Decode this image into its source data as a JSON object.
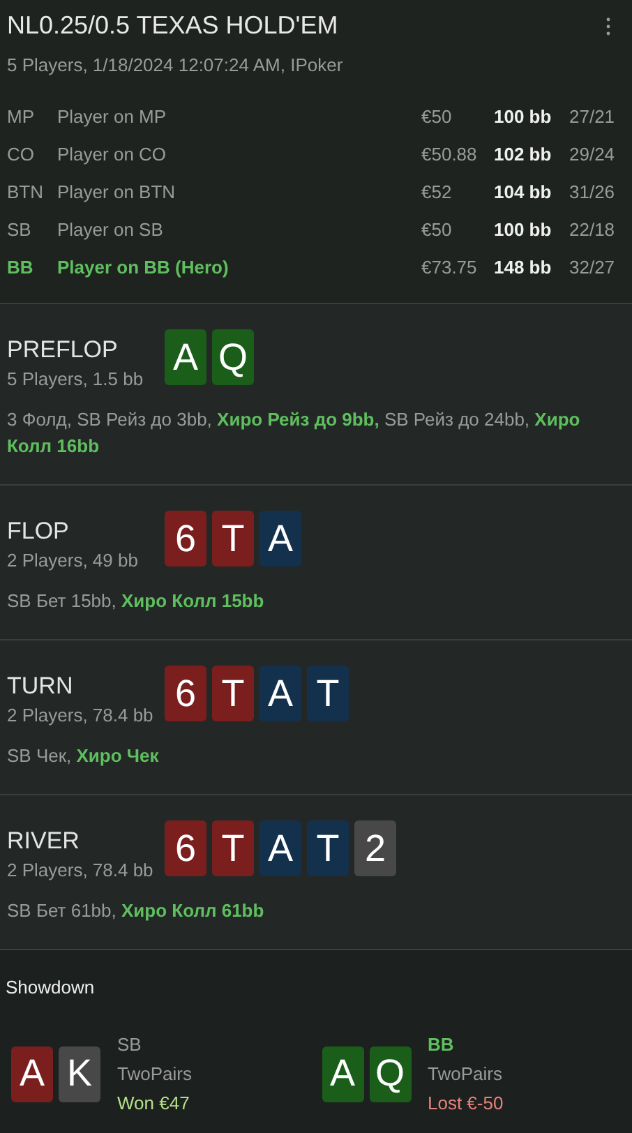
{
  "header": {
    "title": "NL0.25/0.5 TEXAS HOLD'EM",
    "subtitle": "5 Players, 1/18/2024 12:07:24 AM, IPoker"
  },
  "players": [
    {
      "position": "MP",
      "name": "Player on MP",
      "stack": "€50",
      "bb": "100 bb",
      "stats": "27/21",
      "hero": false
    },
    {
      "position": "CO",
      "name": "Player on CO",
      "stack": "€50.88",
      "bb": "102 bb",
      "stats": "29/24",
      "hero": false
    },
    {
      "position": "BTN",
      "name": "Player on BTN",
      "stack": "€52",
      "bb": "104 bb",
      "stats": "31/26",
      "hero": false
    },
    {
      "position": "SB",
      "name": "Player on SB",
      "stack": "€50",
      "bb": "100 bb",
      "stats": "22/18",
      "hero": false
    },
    {
      "position": "BB",
      "name": "Player on BB (Hero)",
      "stack": "€73.75",
      "bb": "148 bb",
      "stats": "32/27",
      "hero": true
    }
  ],
  "streets": [
    {
      "name": "PREFLOP",
      "info": "5 Players, 1.5 bb",
      "cards": [
        {
          "rank": "A",
          "color": "#1a5e1a"
        },
        {
          "rank": "Q",
          "color": "#1a5e1a"
        }
      ],
      "actions": [
        {
          "text": "3 Фолд, SB Рейз до 3bb, ",
          "hero": false
        },
        {
          "text": "Хиро Рейз до 9bb,",
          "hero": true
        },
        {
          "text": " SB Рейз до 24bb, ",
          "hero": false
        },
        {
          "text": "Хиро Колл 16bb",
          "hero": true
        }
      ]
    },
    {
      "name": "FLOP",
      "info": "2 Players, 49 bb",
      "cards": [
        {
          "rank": "6",
          "color": "#7a1e1e"
        },
        {
          "rank": "T",
          "color": "#7a1e1e"
        },
        {
          "rank": "A",
          "color": "#13304d"
        }
      ],
      "actions": [
        {
          "text": "SB Бет 15bb, ",
          "hero": false
        },
        {
          "text": "Хиро Колл 15bb",
          "hero": true
        }
      ]
    },
    {
      "name": "TURN",
      "info": "2 Players, 78.4 bb",
      "cards": [
        {
          "rank": "6",
          "color": "#7a1e1e"
        },
        {
          "rank": "T",
          "color": "#7a1e1e"
        },
        {
          "rank": "A",
          "color": "#13304d"
        },
        {
          "rank": "T",
          "color": "#13304d"
        }
      ],
      "actions": [
        {
          "text": "SB Чек, ",
          "hero": false
        },
        {
          "text": "Хиро Чек",
          "hero": true
        }
      ]
    },
    {
      "name": "RIVER",
      "info": "2 Players, 78.4 bb",
      "cards": [
        {
          "rank": "6",
          "color": "#7a1e1e"
        },
        {
          "rank": "T",
          "color": "#7a1e1e"
        },
        {
          "rank": "A",
          "color": "#13304d"
        },
        {
          "rank": "T",
          "color": "#13304d"
        },
        {
          "rank": "2",
          "color": "#484848"
        }
      ],
      "actions": [
        {
          "text": "SB Бет 61bb, ",
          "hero": false
        },
        {
          "text": "Хиро Колл 61bb",
          "hero": true
        }
      ]
    }
  ],
  "showdown": {
    "title": "Showdown",
    "hands": [
      {
        "position": "SB",
        "hero": false,
        "cards": [
          {
            "rank": "A",
            "color": "#7a1e1e"
          },
          {
            "rank": "K",
            "color": "#484848"
          }
        ],
        "hand": "TwoPairs",
        "result": "Won €47",
        "kind": "won"
      },
      {
        "position": "BB",
        "hero": true,
        "cards": [
          {
            "rank": "A",
            "color": "#1a5e1a"
          },
          {
            "rank": "Q",
            "color": "#1a5e1a"
          }
        ],
        "hand": "TwoPairs",
        "result": "Lost €-50",
        "kind": "lost"
      }
    ]
  }
}
